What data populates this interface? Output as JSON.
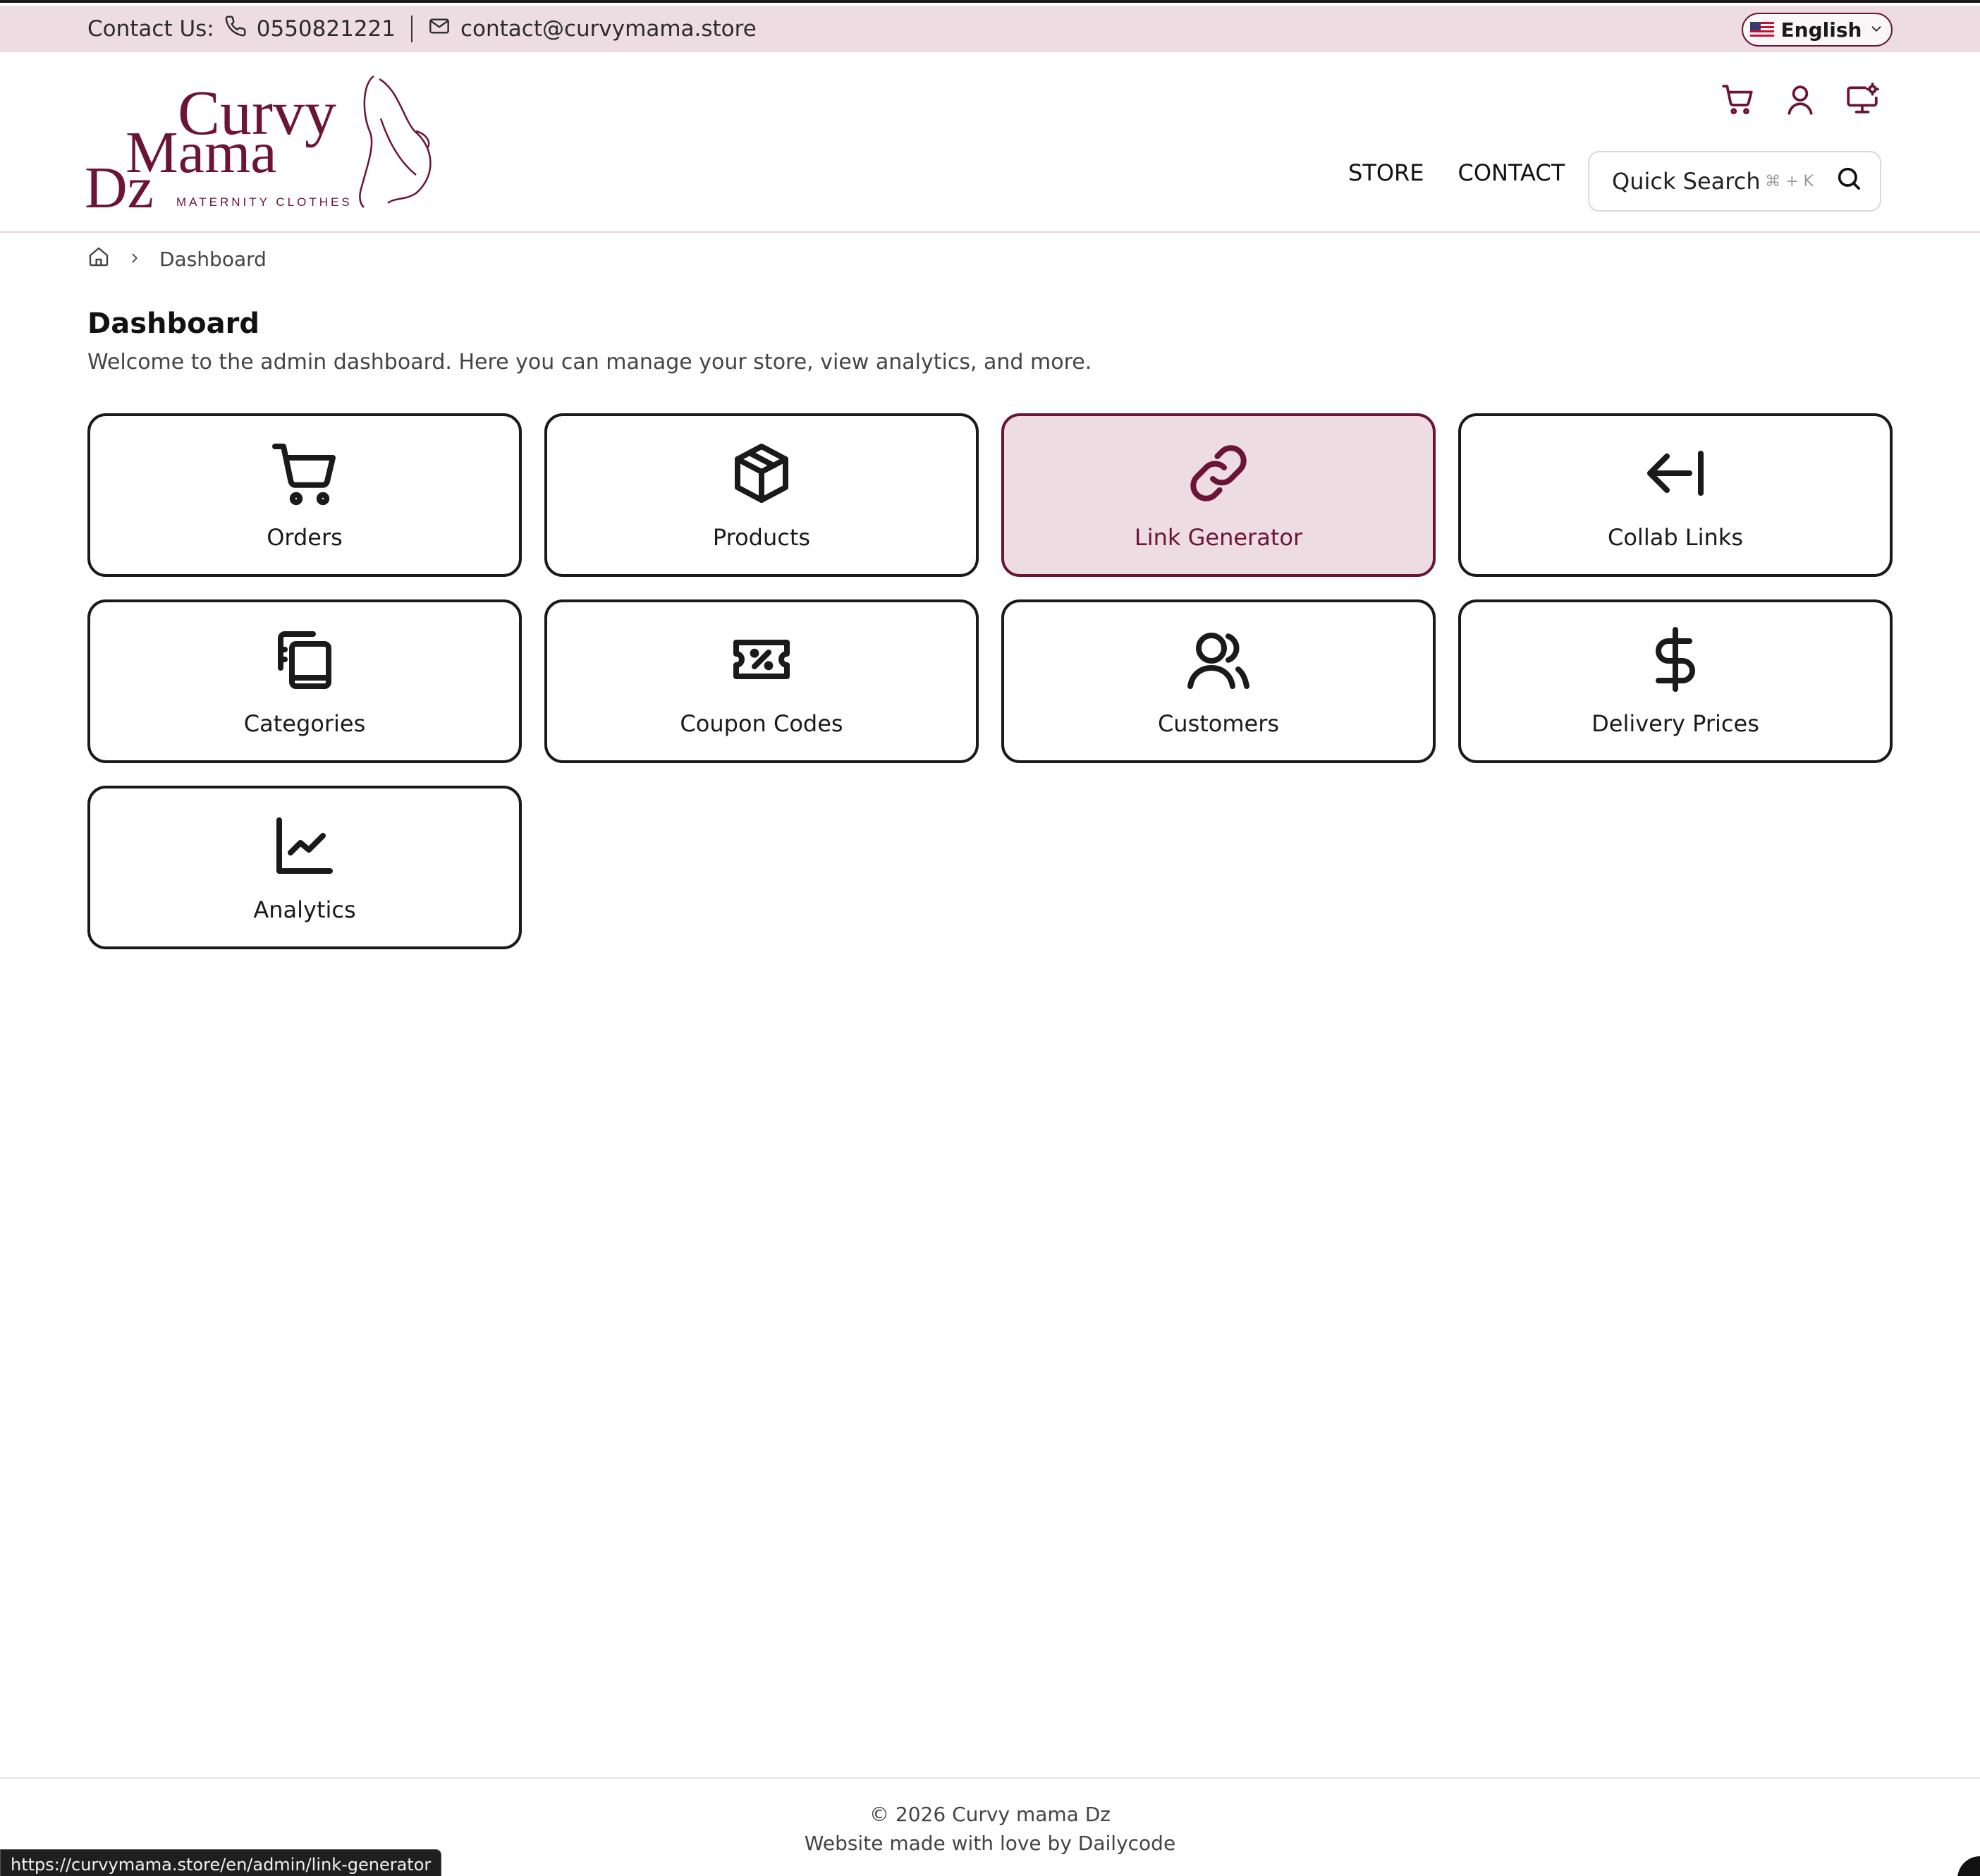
{
  "topbar": {
    "contact_label": "Contact Us:",
    "phone": "0550821221",
    "email": "contact@curvymama.store",
    "language": "English"
  },
  "logo": {
    "line1": "Curvy",
    "line2": "Mama",
    "line3": "Dz",
    "tagline": "MATERNITY CLOTHES"
  },
  "header": {
    "icons": [
      "cart-icon",
      "user-icon",
      "admin-monitor-icon"
    ],
    "nav": [
      "STORE",
      "CONTACT"
    ],
    "search_placeholder": "Quick Search",
    "search_shortcut": "⌘ + K"
  },
  "breadcrumb": {
    "current": "Dashboard"
  },
  "page": {
    "title": "Dashboard",
    "subtitle": "Welcome to the admin dashboard. Here you can manage your store, view analytics, and more."
  },
  "cards": [
    {
      "label": "Orders",
      "icon": "cart-icon"
    },
    {
      "label": "Products",
      "icon": "box-icon"
    },
    {
      "label": "Link Generator",
      "icon": "link-icon",
      "active": true
    },
    {
      "label": "Collab Links",
      "icon": "arrow-left-bar-icon"
    },
    {
      "label": "Categories",
      "icon": "copy-book-icon"
    },
    {
      "label": "Coupon Codes",
      "icon": "ticket-percent-icon"
    },
    {
      "label": "Customers",
      "icon": "users-icon"
    },
    {
      "label": "Delivery Prices",
      "icon": "dollar-icon"
    },
    {
      "label": "Analytics",
      "icon": "line-chart-icon"
    }
  ],
  "footer": {
    "copyright": "© 2026 Curvy mama Dz",
    "credit": "Website made with love by Dailycode"
  },
  "status_url": "https://curvymama.store/en/admin/link-generator",
  "colors": {
    "brand": "#6b1436",
    "brand_light": "#eddde2"
  }
}
